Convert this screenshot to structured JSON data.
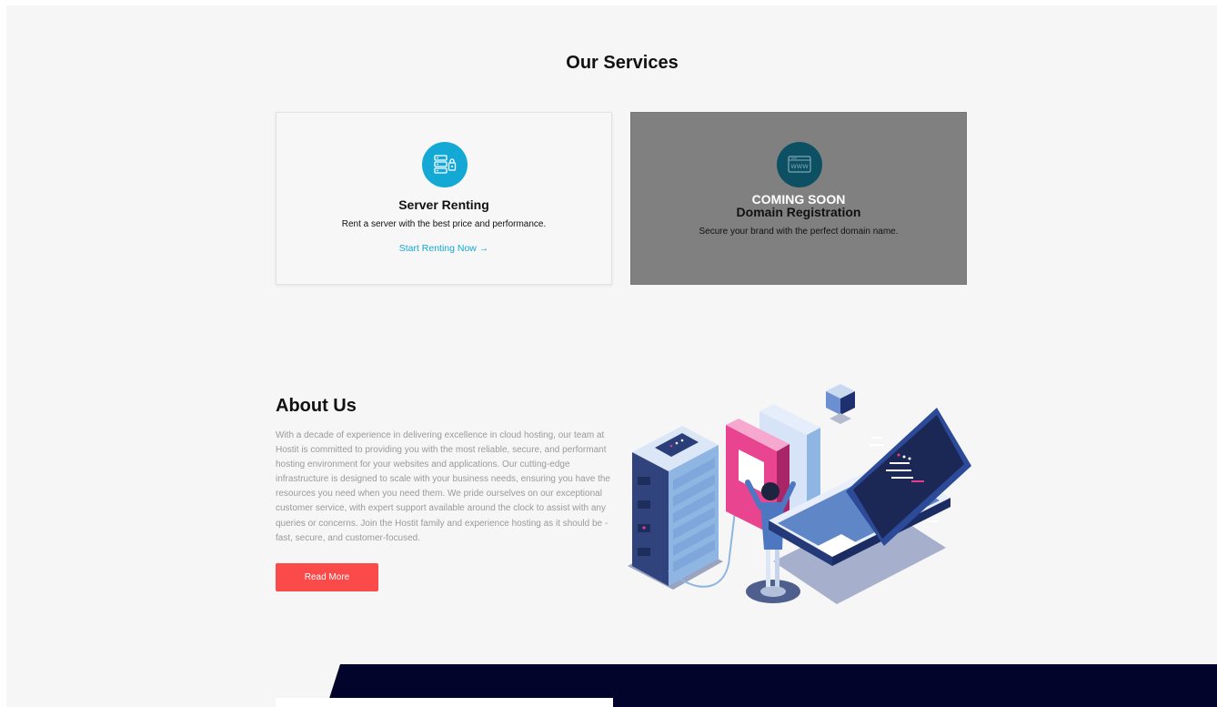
{
  "services": {
    "title": "Our Services",
    "cards": [
      {
        "icon": "server-icon",
        "title": "Server Renting",
        "description": "Rent a server with the best price and performance.",
        "link": "Start Renting Now →"
      },
      {
        "icon": "www-icon",
        "badge": "COMING SOON",
        "title": "Domain Registration",
        "description": "Secure your brand with the perfect domain name."
      }
    ]
  },
  "about": {
    "title": "About Us",
    "text": "With a decade of experience in delivering excellence in cloud hosting, our team at Hostit is committed to providing you with the most reliable, secure, and performant hosting environment for your websites and applications. Our cutting-edge infrastructure is designed to scale with your business needs, ensuring you have the resources you need when you need them. We pride ourselves on our exceptional customer service, with expert support available around the clock to assist with any queries or concerns. Join the Hostit family and experience hosting as it should be - fast, secure, and customer-focused.",
    "button": "Read More",
    "illustration": "server-laptop-illustration"
  },
  "colors": {
    "accent_blue": "#14a9d5",
    "button_red": "#fa4a4a",
    "footer_navy": "#03042b",
    "overlay_gray": "#808080"
  }
}
